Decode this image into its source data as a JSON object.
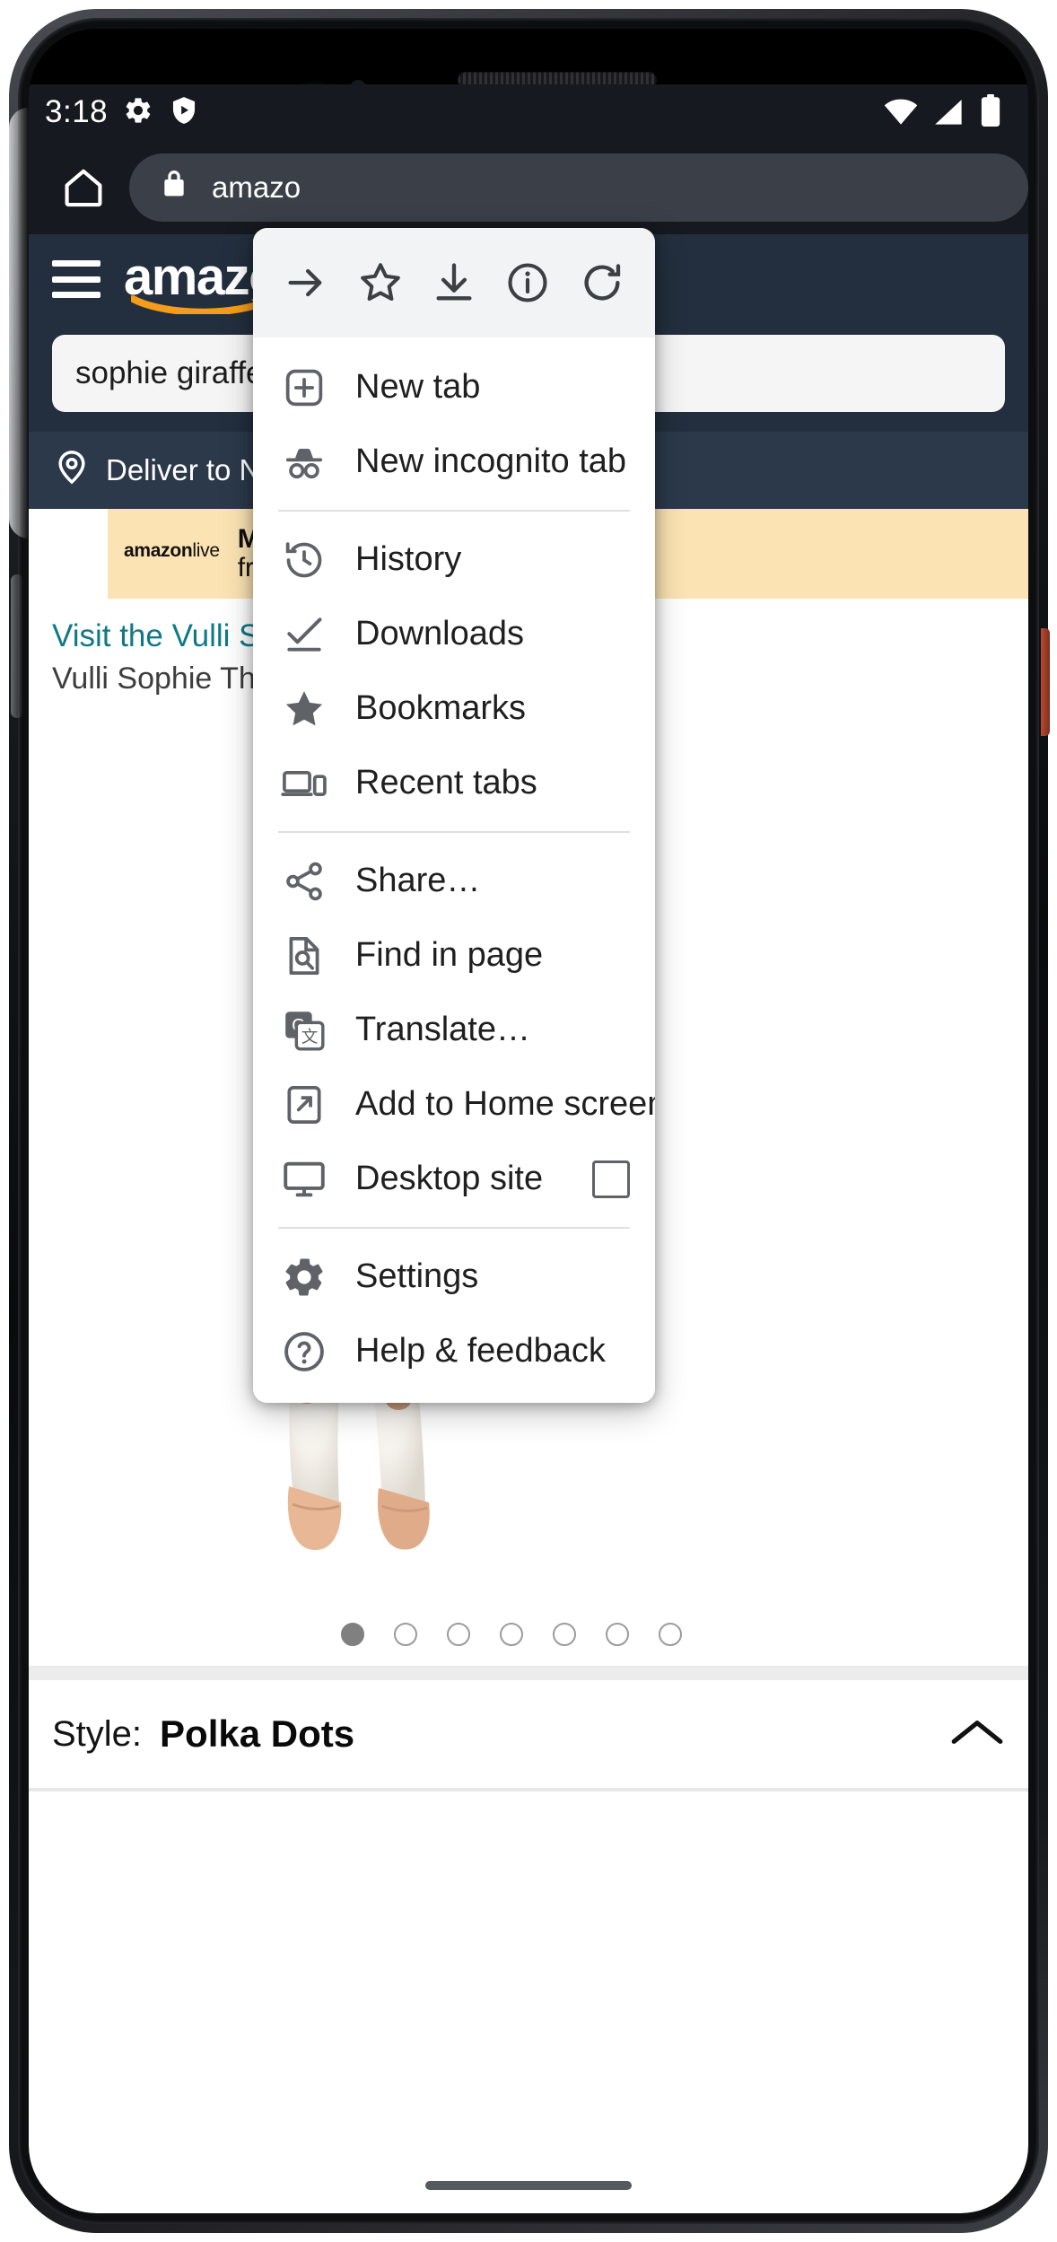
{
  "status_bar": {
    "time": "3:18",
    "left_icons": [
      "gear-icon",
      "shield-play-icon"
    ],
    "right_icons": [
      "wifi-icon",
      "cellular-signal-icon",
      "battery-icon"
    ]
  },
  "browser": {
    "home_icon": "home-icon",
    "lock_icon": "lock-icon",
    "url": "amazo",
    "url_full": "amazon"
  },
  "amazon_page": {
    "menu_icon": "hamburger-menu-icon",
    "logo_text": "amazon",
    "search_value": "sophie giraffe te",
    "deliver_icon": "location-pin-icon",
    "deliver_text": "Deliver to New Y",
    "banner_brand": "amazon",
    "banner_brand_sub": "live",
    "banner_line1": "Must-h",
    "banner_line2": "from",
    "store_link": "Visit the Vulli Store",
    "product_title": "Vulli Sophie The Gir",
    "carousel": {
      "total": 7,
      "active_index": 0
    },
    "style_label": "Style:",
    "style_value": "Polka Dots",
    "style_chevron": "chevron-up-icon"
  },
  "overflow_menu": {
    "header_actions": [
      {
        "name": "forward-icon",
        "label": "Forward"
      },
      {
        "name": "bookmark-star-icon",
        "label": "Bookmark"
      },
      {
        "name": "download-icon",
        "label": "Download"
      },
      {
        "name": "page-info-icon",
        "label": "Page info"
      },
      {
        "name": "reload-icon",
        "label": "Reload"
      }
    ],
    "items": [
      {
        "icon": "new-tab-icon",
        "label": "New tab",
        "divider_after": false,
        "checkbox": false
      },
      {
        "icon": "incognito-icon",
        "label": "New incognito tab",
        "divider_after": true,
        "checkbox": false
      },
      {
        "icon": "history-icon",
        "label": "History",
        "divider_after": false,
        "checkbox": false
      },
      {
        "icon": "downloads-icon",
        "label": "Downloads",
        "divider_after": false,
        "checkbox": false
      },
      {
        "icon": "bookmarks-star-icon",
        "label": "Bookmarks",
        "divider_after": false,
        "checkbox": false
      },
      {
        "icon": "recent-tabs-icon",
        "label": "Recent tabs",
        "divider_after": true,
        "checkbox": false
      },
      {
        "icon": "share-icon",
        "label": "Share…",
        "divider_after": false,
        "checkbox": false
      },
      {
        "icon": "find-in-page-icon",
        "label": "Find in page",
        "divider_after": false,
        "checkbox": false
      },
      {
        "icon": "translate-icon",
        "label": "Translate…",
        "divider_after": false,
        "checkbox": false
      },
      {
        "icon": "add-to-home-screen-icon",
        "label": "Add to Home screen",
        "divider_after": false,
        "checkbox": false
      },
      {
        "icon": "desktop-site-icon",
        "label": "Desktop site",
        "divider_after": true,
        "checkbox": true
      },
      {
        "icon": "settings-gear-icon",
        "label": "Settings",
        "divider_after": false,
        "checkbox": false
      },
      {
        "icon": "help-feedback-icon",
        "label": "Help & feedback",
        "divider_after": false,
        "checkbox": false
      }
    ]
  },
  "colors": {
    "amazon_navy": "#232f3e",
    "amazon_orange": "#f59c1a",
    "chrome_dark": "#16191f",
    "menu_header_bg": "#f1f3f4",
    "icon_grey": "#5f6368",
    "link_teal": "#0f7a85"
  }
}
